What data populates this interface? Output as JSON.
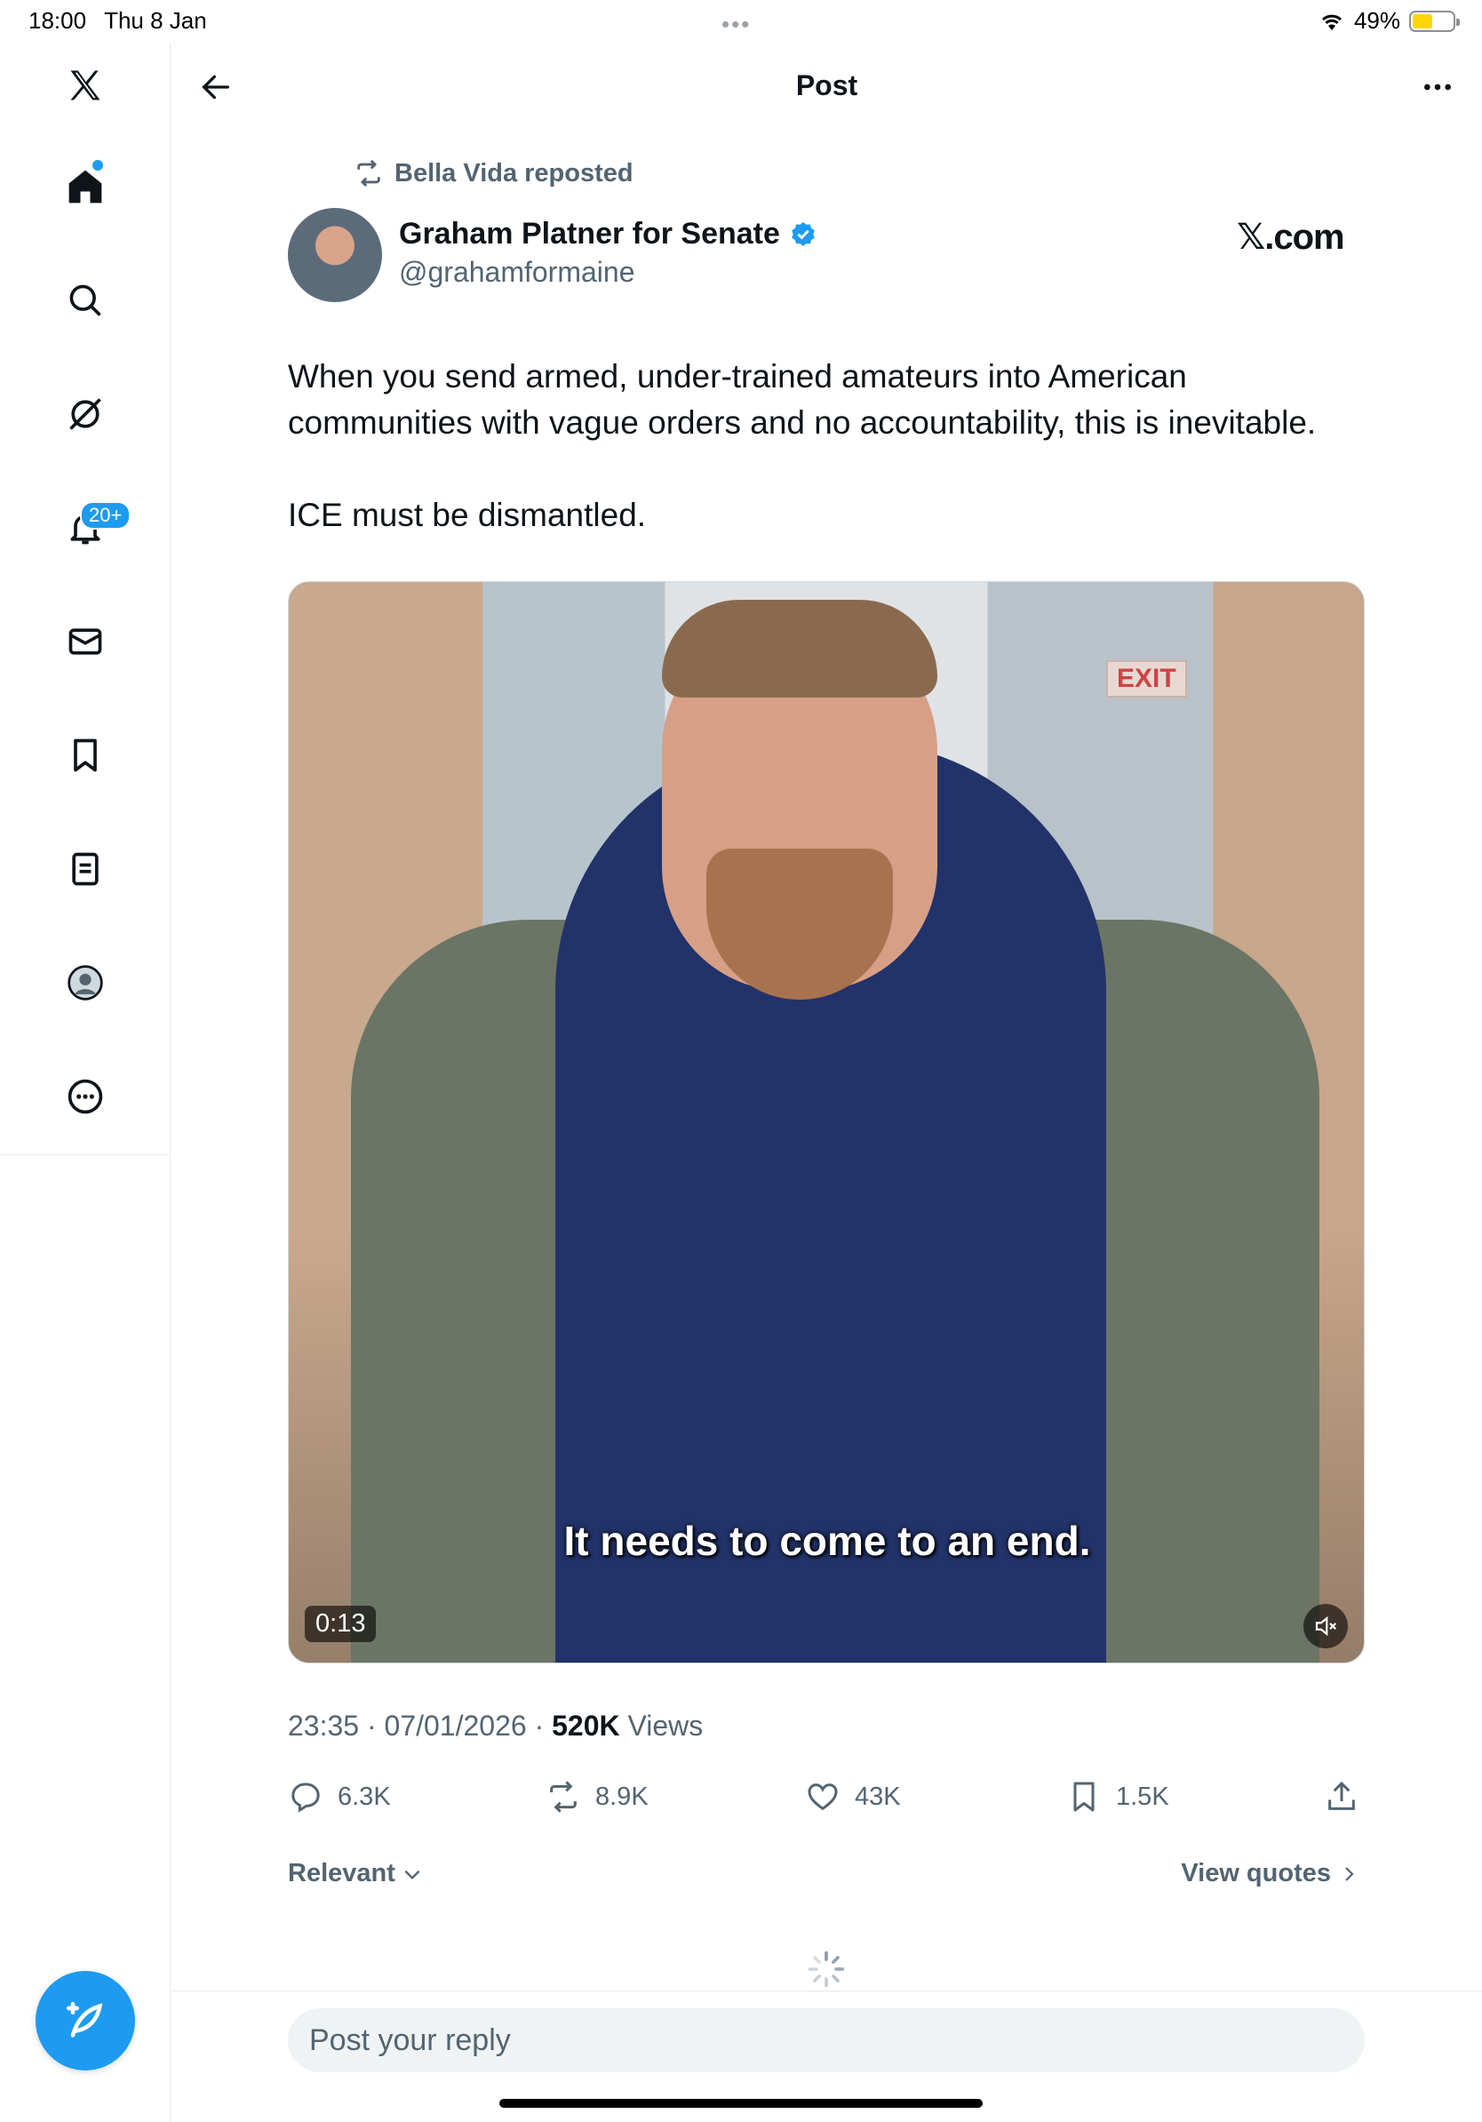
{
  "status_bar": {
    "time": "18:00",
    "date": "Thu 8 Jan",
    "battery": "49%"
  },
  "sidebar": {
    "items": [
      {
        "name": "x-logo-icon"
      },
      {
        "name": "home-icon"
      },
      {
        "name": "search-icon"
      },
      {
        "name": "grok-icon"
      },
      {
        "name": "notifications-icon",
        "badge": "20+"
      },
      {
        "name": "messages-icon"
      },
      {
        "name": "bookmarks-icon"
      },
      {
        "name": "lists-icon"
      },
      {
        "name": "profile-icon"
      },
      {
        "name": "more-icon"
      }
    ]
  },
  "header": {
    "title": "Post"
  },
  "post": {
    "repost_label": "Bella Vida reposted",
    "author_name": "Graham Platner for Senate",
    "author_handle": "@grahamformaine",
    "watermark": "𝕏.com",
    "text_p1": "When you send armed, under-trained amateurs into American communities with vague orders and no accountability, this is inevitable.",
    "text_p2": "ICE must be dismantled.",
    "video": {
      "caption": "It needs to come to an end.",
      "duration": "0:13",
      "sign": "EXIT"
    },
    "time": "23:35",
    "date": "07/01/2026",
    "views_count": "520K",
    "views_label": "Views",
    "stats": {
      "replies": "6.3K",
      "reposts": "8.9K",
      "likes": "43K",
      "bookmarks": "1.5K"
    }
  },
  "sort": {
    "label": "Relevant",
    "view_quotes": "View quotes"
  },
  "reply": {
    "placeholder": "Post your reply"
  },
  "colors": {
    "accent": "#1d9bf0",
    "text": "#0f1419",
    "secondary": "#536471"
  }
}
